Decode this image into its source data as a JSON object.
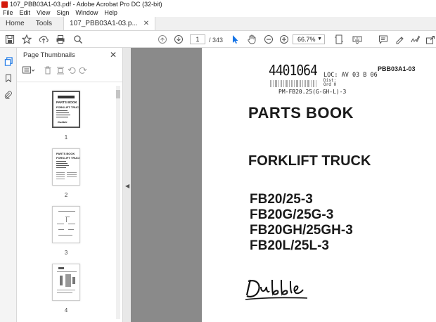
{
  "window": {
    "title": "107_PBB03A1-03.pdf - Adobe Acrobat Pro DC (32-bit)"
  },
  "menu": [
    "File",
    "Edit",
    "View",
    "Sign",
    "Window",
    "Help"
  ],
  "tabs": {
    "home": "Home",
    "tools": "Tools",
    "doc": "107_PBB03A1-03.p..."
  },
  "toolbar": {
    "page_current": "1",
    "page_total": "/ 343",
    "zoom": "66.7%"
  },
  "panel": {
    "title": "Page Thumbnails",
    "thumbnails": [
      {
        "num": "1",
        "selected": true
      },
      {
        "num": "2",
        "selected": false
      },
      {
        "num": "3",
        "selected": false
      },
      {
        "num": "4",
        "selected": false
      }
    ]
  },
  "document": {
    "barcode_number": "4401064",
    "loc_line": "LOC: AV 03 B 06",
    "dist_line1": "Dist:",
    "dist_line2": "Ord    0",
    "pm_ref": "PM-FB20.25(G-GH-L)-3",
    "code": "PBB03A1-03",
    "title": "PARTS BOOK",
    "subtitle": "FORKLIFT TRUCK",
    "models": [
      "FB20/25-3",
      "FB20G/25G-3",
      "FB20GH/25GH-3",
      "FB20L/25L-3"
    ]
  },
  "colors": {
    "accent": "#1473e6",
    "app_red": "#d41a0b",
    "doc_background": "#8a8a8a"
  }
}
